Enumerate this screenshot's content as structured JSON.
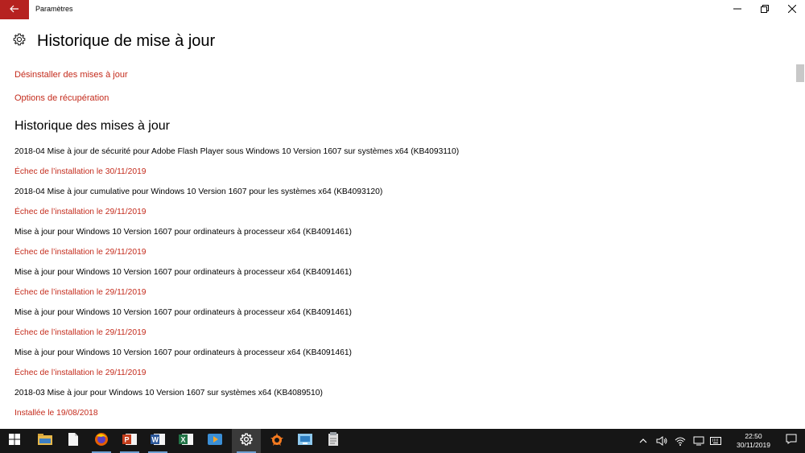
{
  "window": {
    "title": "Paramètres",
    "back_icon": "back-arrow-icon",
    "controls": [
      "minimize-icon",
      "restore-icon",
      "close-icon"
    ]
  },
  "header": {
    "icon": "gear-icon",
    "title": "Historique de mise à jour"
  },
  "links": {
    "uninstall": "Désinstaller des mises à jour",
    "recovery": "Options de récupération"
  },
  "history": {
    "heading": "Historique des mises à jour",
    "items": [
      {
        "name": "2018-04 Mise à jour de sécurité pour Adobe Flash Player sous Windows 10 Version 1607 sur systèmes x64 (KB4093110)",
        "status": "Échec de l’installation le 30/11/2019"
      },
      {
        "name": "2018-04 Mise à jour cumulative pour Windows 10 Version 1607 pour les systèmes x64 (KB4093120)",
        "status": "Échec de l’installation le 29/11/2019"
      },
      {
        "name": "Mise à jour pour Windows 10 Version 1607 pour ordinateurs à processeur x64 (KB4091461)",
        "status": "Échec de l’installation le 29/11/2019"
      },
      {
        "name": "Mise à jour pour Windows 10 Version 1607 pour ordinateurs à processeur x64 (KB4091461)",
        "status": "Échec de l’installation le 29/11/2019"
      },
      {
        "name": "Mise à jour pour Windows 10 Version 1607 pour ordinateurs à processeur x64 (KB4091461)",
        "status": "Échec de l’installation le 29/11/2019"
      },
      {
        "name": "Mise à jour pour Windows 10 Version 1607 pour ordinateurs à processeur x64 (KB4091461)",
        "status": "Échec de l’installation le 29/11/2019"
      },
      {
        "name": "2018-03 Mise à jour pour Windows 10 Version 1607 sur systèmes x64 (KB4089510)",
        "status": "Installée le 19/08/2018"
      }
    ]
  },
  "taskbar": {
    "apps": [
      "windows-start-icon",
      "file-explorer-icon",
      "notepad-icon",
      "firefox-icon",
      "powerpoint-icon",
      "word-icon",
      "excel-icon",
      "media-player-icon",
      "settings-icon",
      "avast-icon",
      "network-app-icon",
      "document-app-icon"
    ],
    "tray": [
      "chevron-up-icon",
      "volume-icon",
      "wifi-icon",
      "display-icon",
      "battery-icon",
      "keyboard-icon"
    ],
    "clock_time": "22:50",
    "clock_date": "30/11/2019",
    "notification_icon": "action-center-icon"
  },
  "colors": {
    "accent": "#c42b1c",
    "back_button": "#b62220",
    "taskbar": "#161616"
  }
}
